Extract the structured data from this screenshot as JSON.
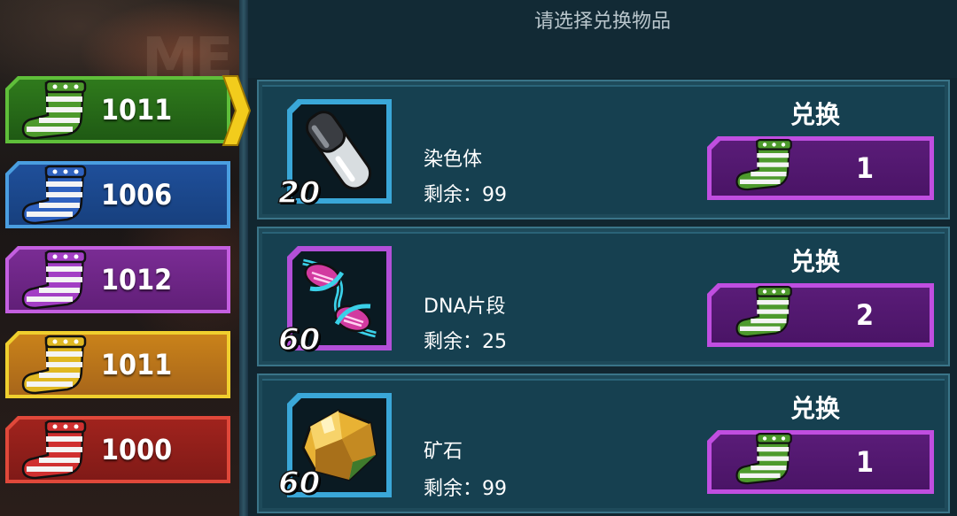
{
  "header": {
    "title": "请选择兑换物品"
  },
  "background": {
    "ghost_text": "ME"
  },
  "tabs": [
    {
      "color": "green",
      "count": "1011",
      "selected": true
    },
    {
      "color": "blue",
      "count": "1006",
      "selected": false
    },
    {
      "color": "purple",
      "count": "1012",
      "selected": false
    },
    {
      "color": "yellow",
      "count": "1011",
      "selected": false
    },
    {
      "color": "red",
      "count": "1000",
      "selected": false
    }
  ],
  "items": [
    {
      "name": "染色体",
      "quantity": "20",
      "remaining": "剩余：99",
      "exchange_label": "兑换",
      "cost": "1",
      "icon": "test-tube-icon"
    },
    {
      "name": "DNA片段",
      "quantity": "60",
      "remaining": "剩余：25",
      "exchange_label": "兑换",
      "cost": "2",
      "icon": "dna-helix-icon"
    },
    {
      "name": "矿石",
      "quantity": "60",
      "remaining": "剩余：99",
      "exchange_label": "兑换",
      "cost": "1",
      "icon": "ore-crystal-icon"
    }
  ],
  "colors": {
    "green": "#5fbf3a",
    "blue": "#4a9ee0",
    "purple": "#c45fe0",
    "yellow": "#f0cf2e",
    "red": "#e0483a"
  }
}
